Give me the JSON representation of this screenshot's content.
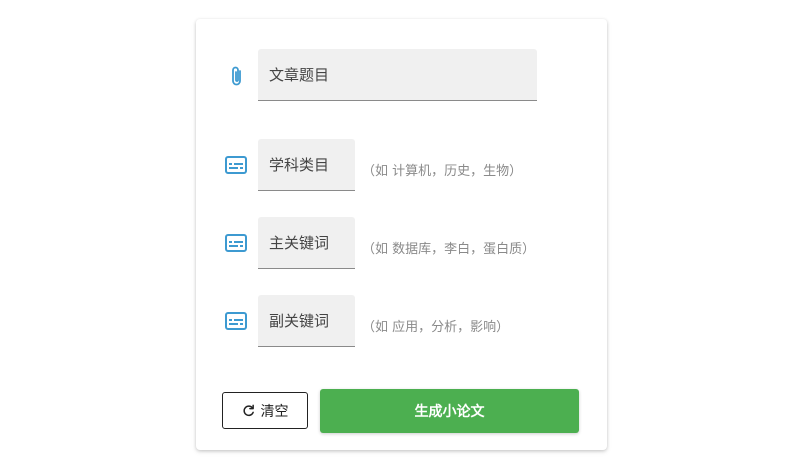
{
  "form": {
    "title_field": {
      "placeholder": "文章题目",
      "value": ""
    },
    "subject_field": {
      "placeholder": "学科类目",
      "value": "",
      "hint": "（如 计算机，历史，生物）"
    },
    "main_keyword_field": {
      "placeholder": "主关键词",
      "value": "",
      "hint": "（如 数据库，李白，蛋白质）"
    },
    "sub_keyword_field": {
      "placeholder": "副关键词",
      "value": "",
      "hint": "（如 应用，分析，影响）"
    }
  },
  "actions": {
    "clear_label": "清空",
    "generate_label": "生成小论文"
  },
  "icons": {
    "title": "paperclip-icon",
    "fields": "subtitles-icon",
    "clear": "refresh-icon"
  },
  "colors": {
    "accent": "#3d9ad1",
    "primary_button": "#4caf50"
  }
}
